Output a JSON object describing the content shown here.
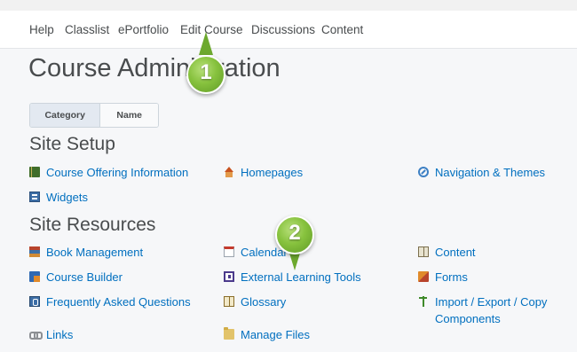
{
  "nav": {
    "items": [
      "Help",
      "Classlist",
      "ePortfolio",
      "Edit Course",
      "Discussions",
      "Content"
    ]
  },
  "page": {
    "title": "Course Administration"
  },
  "view_toggle": {
    "category": "Category",
    "name": "Name"
  },
  "sections": {
    "site_setup": {
      "title": "Site Setup",
      "tools": [
        {
          "label": "Course Offering Information",
          "icon": "book-icon"
        },
        {
          "label": "Homepages",
          "icon": "house-icon"
        },
        {
          "label": "Navigation & Themes",
          "icon": "compass-icon"
        },
        {
          "label": "Widgets",
          "icon": "widgets-icon"
        }
      ]
    },
    "site_resources": {
      "title": "Site Resources",
      "tools": [
        {
          "label": "Book Management",
          "icon": "books-icon"
        },
        {
          "label": "Calendar",
          "icon": "calendar-icon"
        },
        {
          "label": "Content",
          "icon": "open-book-icon"
        },
        {
          "label": "Course Builder",
          "icon": "builder-icon"
        },
        {
          "label": "External Learning Tools",
          "icon": "external-tool-icon"
        },
        {
          "label": "Forms",
          "icon": "forms-icon"
        },
        {
          "label": "Frequently Asked Questions",
          "icon": "faq-icon"
        },
        {
          "label": "Glossary",
          "icon": "glossary-icon"
        },
        {
          "label": "Import / Export / Copy Components",
          "icon": "import-export-icon"
        },
        {
          "label": "Links",
          "icon": "link-icon"
        },
        {
          "label": "Manage Files",
          "icon": "folder-icon"
        }
      ]
    }
  },
  "callouts": {
    "one": "1",
    "two": "2"
  },
  "colors": {
    "link": "#006fbf",
    "callout": "#87c23e",
    "text": "#494c4e"
  }
}
